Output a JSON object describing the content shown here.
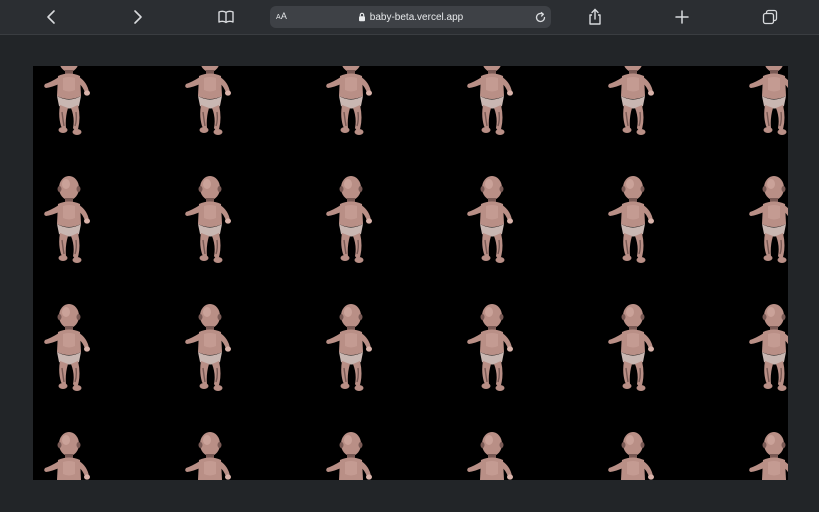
{
  "browser": {
    "url": "baby-beta.vercel.app",
    "reader_label_big": "A",
    "reader_label_small": "A",
    "icons": {
      "back": "chevron-left-icon",
      "forward": "chevron-right-icon",
      "bookmarks": "book-icon",
      "lock": "lock-icon",
      "reload": "reload-icon",
      "share": "share-icon",
      "new_tab": "plus-icon",
      "tabs": "tabs-icon"
    },
    "colors": {
      "toolbar": "#2b2e32",
      "address_bar": "#3e4146",
      "icon": "#d8dadd",
      "page_background": "#222528"
    }
  },
  "page": {
    "stage_background": "#000000",
    "figure_colors": {
      "skin": "#b98f86",
      "shade": "#7a5a55",
      "highlight": "#d9b3aa"
    },
    "grid": {
      "columns": 6,
      "rows": 4
    }
  }
}
